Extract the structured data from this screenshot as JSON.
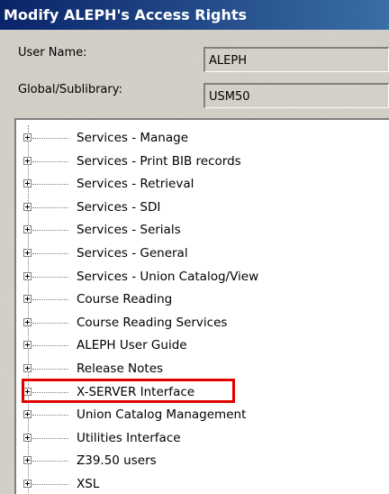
{
  "window": {
    "title": "Modify ALEPH's Access Rights"
  },
  "form": {
    "user_name_label": "User Name:",
    "user_name_value": "ALEPH",
    "global_sublibrary_label": "Global/Sublibrary:",
    "global_sublibrary_value": "USM50"
  },
  "tree": {
    "items": [
      {
        "label": "Services - Manage"
      },
      {
        "label": "Services - Print BIB records"
      },
      {
        "label": "Services - Retrieval"
      },
      {
        "label": "Services - SDI"
      },
      {
        "label": "Services - Serials"
      },
      {
        "label": "Services - General"
      },
      {
        "label": "Services - Union Catalog/View"
      },
      {
        "label": "Course Reading"
      },
      {
        "label": "Course Reading Services"
      },
      {
        "label": "ALEPH User Guide"
      },
      {
        "label": "Release Notes"
      },
      {
        "label": "X-SERVER Interface",
        "highlighted": true
      },
      {
        "label": "Union Catalog Management"
      },
      {
        "label": "Utilities Interface"
      },
      {
        "label": "Z39.50 users"
      },
      {
        "label": "XSL"
      }
    ]
  },
  "colors": {
    "titlebar_start": "#0a246a",
    "titlebar_end": "#3a6ea5",
    "highlight_border": "#e00000"
  },
  "icons": {
    "expander": "plus-box-icon"
  }
}
